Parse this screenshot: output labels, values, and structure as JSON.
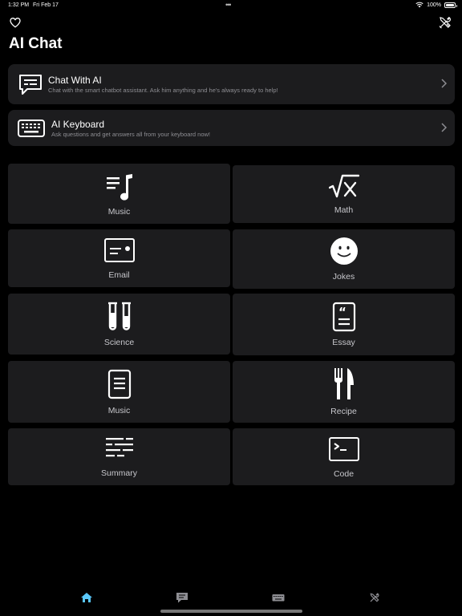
{
  "status_bar": {
    "time": "1:32 PM",
    "date": "Fri Feb 17",
    "battery": "100%"
  },
  "header": {
    "title": "AI Chat",
    "favorites_icon": "heart-icon",
    "tools_icon": "tools-icon"
  },
  "features": [
    {
      "title": "Chat With AI",
      "subtitle": "Chat with the smart chatbot assistant. Ask him anything and he's always ready to help!",
      "icon": "chat-bubble-icon"
    },
    {
      "title": "AI Keyboard",
      "subtitle": "Ask questions and get answers all from your keyboard now!",
      "icon": "keyboard-icon"
    }
  ],
  "categories": [
    {
      "label": "Music",
      "icon": "music-list-icon"
    },
    {
      "label": "Math",
      "icon": "square-root-icon"
    },
    {
      "label": "Email",
      "icon": "email-card-icon"
    },
    {
      "label": "Jokes",
      "icon": "smiley-icon"
    },
    {
      "label": "Science",
      "icon": "test-tubes-icon"
    },
    {
      "label": "Essay",
      "icon": "quote-document-icon"
    },
    {
      "label": "Music",
      "icon": "document-icon"
    },
    {
      "label": "Recipe",
      "icon": "fork-knife-icon"
    },
    {
      "label": "Summary",
      "icon": "text-lines-icon"
    },
    {
      "label": "Code",
      "icon": "terminal-icon"
    }
  ],
  "tabbar": {
    "tabs": [
      {
        "name": "home",
        "icon": "house-icon",
        "selected": true
      },
      {
        "name": "chat",
        "icon": "chat-icon",
        "selected": false
      },
      {
        "name": "keyboard",
        "icon": "keyboard-icon",
        "selected": false
      },
      {
        "name": "tools",
        "icon": "tools-icon",
        "selected": false
      }
    ],
    "accent": "#5ac8fa"
  },
  "colors": {
    "background": "#000000",
    "card": "#1c1c1e",
    "subtitle": "#8e8e93"
  }
}
